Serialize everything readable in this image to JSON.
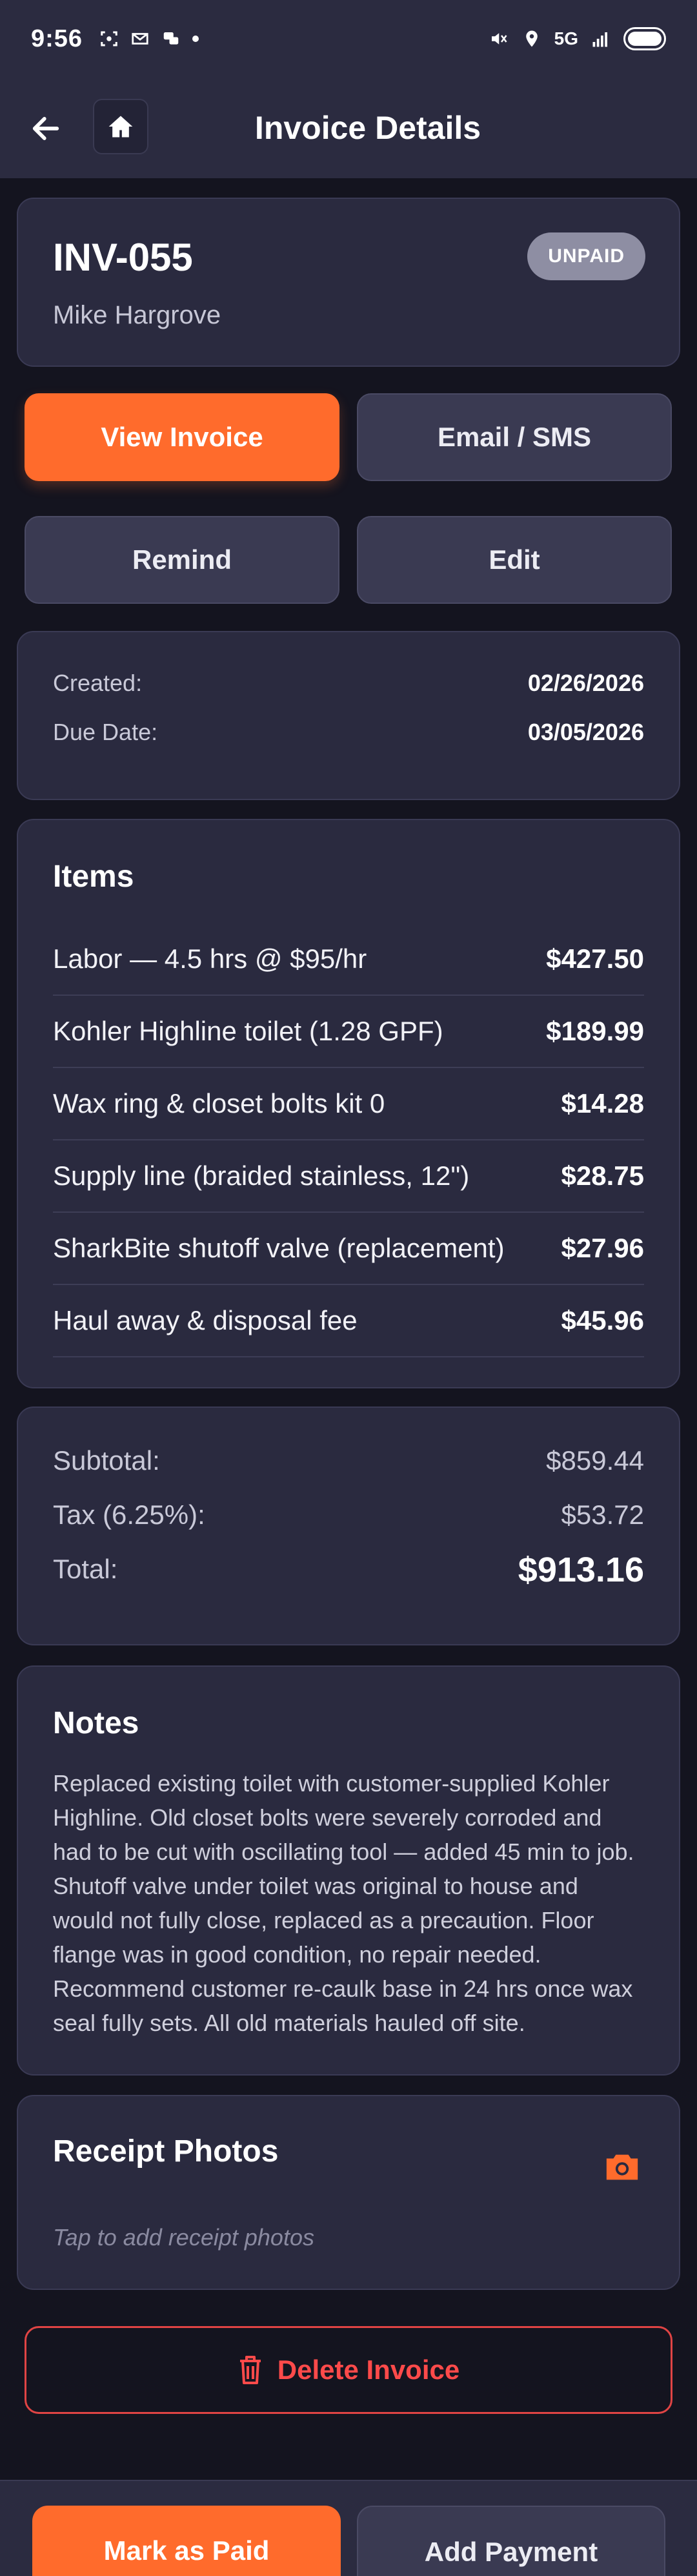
{
  "status_bar": {
    "time": "9:56",
    "network": "5G",
    "icons": [
      "scan-icon",
      "gmail-icon",
      "chat-icon",
      "dot-icon",
      "mute-icon",
      "location-icon",
      "signal-icon",
      "battery-icon"
    ]
  },
  "header": {
    "title": "Invoice Details",
    "back_icon": "arrow-left-icon",
    "home_icon": "home-icon"
  },
  "invoice": {
    "number": "INV-055",
    "client": "Mike Hargrove",
    "status": "UNPAID"
  },
  "actions": {
    "view_invoice": "View Invoice",
    "email_sms": "Email / SMS",
    "remind": "Remind",
    "edit": "Edit"
  },
  "dates": {
    "created_label": "Created:",
    "created_value": "02/26/2026",
    "due_label": "Due Date:",
    "due_value": "03/05/2026"
  },
  "items": {
    "title": "Items",
    "rows": [
      {
        "desc": "Labor — 4.5 hrs @ $95/hr",
        "amount": "$427.50"
      },
      {
        "desc": "Kohler Highline toilet (1.28 GPF)",
        "amount": "$189.99"
      },
      {
        "desc": "Wax ring & closet bolts kit 0",
        "amount": "$14.28"
      },
      {
        "desc": "Supply line (braided stainless, 12\")",
        "amount": "$28.75"
      },
      {
        "desc": "SharkBite shutoff valve (replacement)",
        "amount": "$27.96"
      },
      {
        "desc": "Haul away & disposal fee",
        "amount": "$45.96"
      }
    ]
  },
  "totals": {
    "subtotal_label": "Subtotal:",
    "subtotal_value": "$859.44",
    "tax_label": "Tax (6.25%):",
    "tax_value": "$53.72",
    "total_label": "Total:",
    "total_value": "$913.16"
  },
  "notes": {
    "title": "Notes",
    "text": "Replaced existing toilet with customer-supplied Kohler Highline. Old closet bolts were severely corroded and had to be cut with oscillating tool — added 45 min to job. Shutoff valve under toilet was original to house and would not fully close, replaced as a precaution. Floor flange was in good condition, no repair needed. Recommend customer re-caulk base in 24 hrs once wax seal fully sets. All old materials hauled off site."
  },
  "receipts": {
    "title": "Receipt Photos",
    "placeholder": "Tap to add receipt photos",
    "icon": "camera-icon"
  },
  "delete": {
    "label": "Delete Invoice",
    "icon": "trash-icon"
  },
  "bottom": {
    "mark_paid": "Mark as Paid",
    "add_payment": "Add Payment"
  },
  "colors": {
    "accent": "#ff6b2c",
    "danger": "#ff4a4a",
    "card": "#2a2a3f",
    "background": "#14141f"
  }
}
